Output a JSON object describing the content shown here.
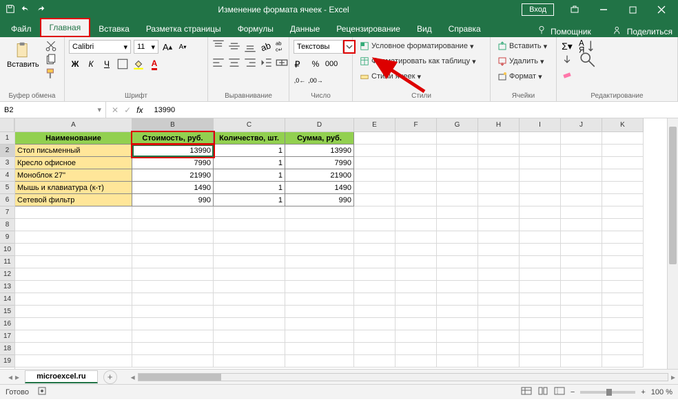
{
  "titlebar": {
    "title": "Изменение формата ячеек  -  Excel",
    "login": "Вход"
  },
  "tabs": {
    "file": "Файл",
    "home": "Главная",
    "insert": "Вставка",
    "layout": "Разметка страницы",
    "formulas": "Формулы",
    "data": "Данные",
    "review": "Рецензирование",
    "view": "Вид",
    "help": "Справка",
    "tellme": "Помощник",
    "share": "Поделиться"
  },
  "ribbon": {
    "clipboard": {
      "paste": "Вставить",
      "label": "Буфер обмена"
    },
    "font": {
      "name": "Calibri",
      "size": "11",
      "label": "Шрифт"
    },
    "align": {
      "label": "Выравнивание"
    },
    "number": {
      "format": "Текстовы",
      "label": "Число"
    },
    "styles": {
      "cond": "Условное форматирование",
      "table": "Форматировать как таблицу",
      "cells": "Стили ячеек",
      "label": "Стили"
    },
    "cells": {
      "insert": "Вставить",
      "delete": "Удалить",
      "format": "Формат",
      "label": "Ячейки"
    },
    "editing": {
      "label": "Редактирование"
    }
  },
  "namebox": "B2",
  "formula": "13990",
  "columns": [
    "A",
    "B",
    "C",
    "D",
    "E",
    "F",
    "G",
    "H",
    "I",
    "J",
    "K"
  ],
  "colwidths": [
    "colA",
    "colB",
    "colC",
    "colD",
    "colDef",
    "colDef",
    "colDef",
    "colDef",
    "colDef",
    "colDef",
    "colDef"
  ],
  "headers": [
    "Наименование",
    "Стоимость, руб.",
    "Количество, шт.",
    "Сумма, руб."
  ],
  "rows": [
    {
      "name": "Стол письменный",
      "cost": "13990",
      "qty": "1",
      "sum": "13990"
    },
    {
      "name": "Кресло офисное",
      "cost": "7990",
      "qty": "1",
      "sum": "7990"
    },
    {
      "name": "Моноблок 27\"",
      "cost": "21990",
      "qty": "1",
      "sum": "21900"
    },
    {
      "name": "Мышь и клавиатура (к-т)",
      "cost": "1490",
      "qty": "1",
      "sum": "1490"
    },
    {
      "name": "Сетевой фильтр",
      "cost": "990",
      "qty": "1",
      "sum": "990"
    }
  ],
  "sheet": "microexcel.ru",
  "status": {
    "ready": "Готово",
    "zoom": "100 %"
  }
}
